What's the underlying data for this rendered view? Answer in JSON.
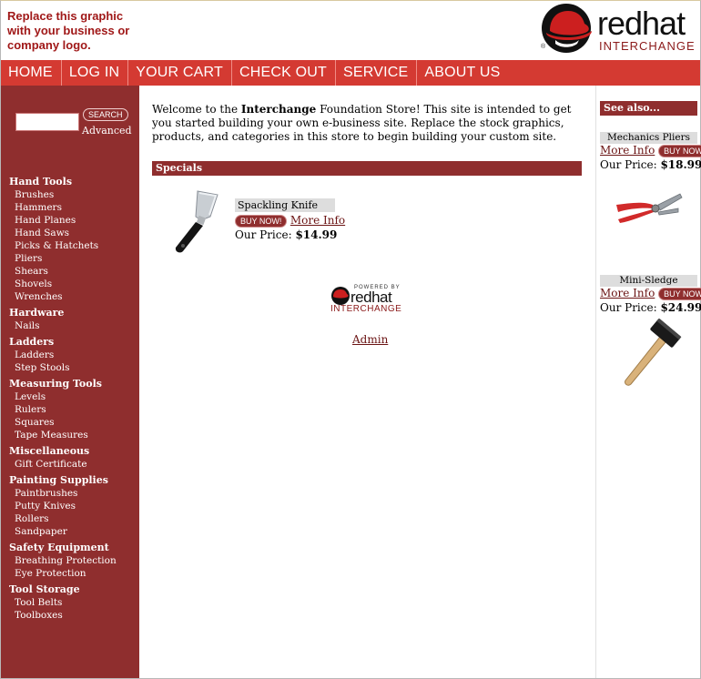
{
  "header": {
    "logo_placeholder_text": "Replace this graphic with your business or company logo.",
    "brand_word": "redhat",
    "brand_sub": "INTERCHANGE",
    "reg_mark": "®"
  },
  "nav": {
    "items": [
      {
        "label": "HOME"
      },
      {
        "label": "LOG IN"
      },
      {
        "label": "YOUR CART"
      },
      {
        "label": "CHECK OUT"
      },
      {
        "label": "SERVICE"
      },
      {
        "label": "ABOUT US"
      }
    ]
  },
  "search": {
    "value": "",
    "button_label": "SEARCH",
    "advanced_label": "Advanced"
  },
  "categories": [
    {
      "title": "Hand Tools",
      "items": [
        "Brushes",
        "Hammers",
        "Hand Planes",
        "Hand Saws",
        "Picks & Hatchets",
        "Pliers",
        "Shears",
        "Shovels",
        "Wrenches"
      ]
    },
    {
      "title": "Hardware",
      "items": [
        "Nails"
      ]
    },
    {
      "title": "Ladders",
      "items": [
        "Ladders",
        "Step Stools"
      ]
    },
    {
      "title": "Measuring Tools",
      "items": [
        "Levels",
        "Rulers",
        "Squares",
        "Tape Measures"
      ]
    },
    {
      "title": "Miscellaneous",
      "items": [
        "Gift Certificate"
      ]
    },
    {
      "title": "Painting Supplies",
      "items": [
        "Paintbrushes",
        "Putty Knives",
        "Rollers",
        "Sandpaper"
      ]
    },
    {
      "title": "Safety Equipment",
      "items": [
        "Breathing Protection",
        "Eye Protection"
      ]
    },
    {
      "title": "Tool Storage",
      "items": [
        "Tool Belts",
        "Toolboxes"
      ]
    }
  ],
  "main": {
    "welcome_before": "Welcome to the ",
    "welcome_bold": "Interchange",
    "welcome_after": " Foundation Store! This site is intended to get you started building your own e-business site. Replace the stock graphics, products, and categories in this store to begin building your custom site.",
    "specials_title": "Specials",
    "special": {
      "name": "Spackling Knife",
      "buy_label": "BUY NOW!",
      "more_label": "More Info",
      "price_label": "Our Price: ",
      "price": "$14.99"
    },
    "powered_by": "POWERED BY",
    "powered_word": "redhat",
    "powered_sub": "INTERCHANGE",
    "admin_label": "Admin"
  },
  "right": {
    "title": "See also...",
    "items": [
      {
        "name": "Mechanics Pliers",
        "more_label": "More Info",
        "buy_label": "BUY NOW!",
        "price_label": "Our Price: ",
        "price": "$18.99"
      },
      {
        "name": "Mini-Sledge",
        "more_label": "More Info",
        "buy_label": "BUY NOW!",
        "price_label": "Our Price: ",
        "price": "$24.99"
      }
    ]
  },
  "colors": {
    "nav_bg": "#d43a32",
    "sidebar_bg": "#8f2e2e",
    "link": "#6b1414",
    "logo_text": "#a01818"
  }
}
